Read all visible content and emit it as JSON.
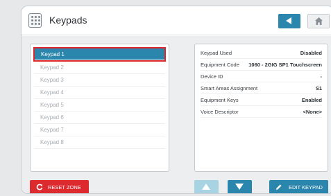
{
  "header": {
    "title": "Keypads",
    "icon": "keypad-icon",
    "back_icon": "back-arrow-icon",
    "home_icon": "home-icon"
  },
  "keypads": [
    {
      "label": "Keypad 1",
      "selected": true
    },
    {
      "label": "Keypad 2"
    },
    {
      "label": "Keypad 3"
    },
    {
      "label": "Keypad 4"
    },
    {
      "label": "Keypad 5"
    },
    {
      "label": "Keypad 6"
    },
    {
      "label": "Keypad 7"
    },
    {
      "label": "Keypad 8"
    }
  ],
  "details": [
    {
      "label": "Keypad Used",
      "value": "Disabled"
    },
    {
      "label": "Equipment Code",
      "value": "1060 - 2GIG SP1 Touchscreen"
    },
    {
      "label": "Device ID",
      "value": "-"
    },
    {
      "label": "Smart Areas Assignment",
      "value": "S1"
    },
    {
      "label": "Equipment Keys",
      "value": "Enabled"
    },
    {
      "label": "Voice Descriptor",
      "value": "<None>"
    }
  ],
  "footer": {
    "reset_label": "RESET ZONE",
    "edit_label": "EDIT KEYPAD",
    "up_icon": "arrow-up-icon",
    "down_icon": "arrow-down-icon"
  },
  "colors": {
    "accent": "#2a86ac",
    "danger": "#dd2a2f",
    "selection_outline": "#e0262d",
    "disabled_button": "#a7d3e3"
  }
}
